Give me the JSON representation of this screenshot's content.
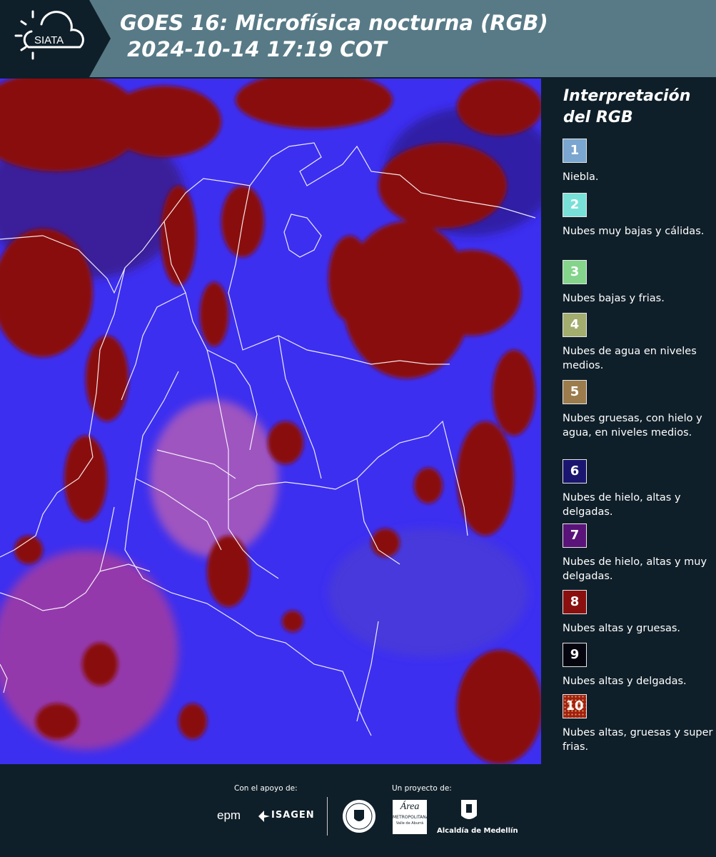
{
  "header": {
    "logo_text": "SIATA",
    "title_line1": "GOES 16: Microfísica nocturna (RGB)",
    "title_line2": " 2024-10-14 17:19 COT"
  },
  "legend": {
    "title_line1": "Interpretación",
    "title_line2": "del RGB",
    "items": [
      {
        "num": "1",
        "label": "Niebla.",
        "color": "#7aa6cf"
      },
      {
        "num": "2",
        "label": "Nubes muy bajas y cálidas.",
        "color": "#79e0d8"
      },
      {
        "num": "3",
        "label": "Nubes bajas y frias.",
        "color": "#84d48c"
      },
      {
        "num": "4",
        "label": "Nubes de agua en niveles medios.",
        "color": "#a2ad6e"
      },
      {
        "num": "5",
        "label": "Nubes gruesas, con hielo y agua, en niveles medios.",
        "color": "#9c7c4c"
      },
      {
        "num": "6",
        "label": "Nubes de hielo, altas y delgadas.",
        "color": "#1a1670"
      },
      {
        "num": "7",
        "label": "Nubes de hielo, altas y muy delgadas.",
        "color": "#5a1378"
      },
      {
        "num": "8",
        "label": "Nubes altas y gruesas.",
        "color": "#8a1010"
      },
      {
        "num": "9",
        "label": "Nubes altas y delgadas.",
        "color": "#050510"
      },
      {
        "num": "10",
        "label": "Nubes altas, gruesas y super frias.",
        "color": "#a02010"
      }
    ]
  },
  "footer": {
    "support_label": "Con el apoyo de:",
    "project_label": "Un proyecto de:",
    "logo_epm": "epm",
    "logo_isagen": "ISAGEN",
    "logo_area_line1": "Área",
    "logo_area_line2": "METROPOLITANA",
    "logo_area_line3": "Valle de Aburrá",
    "logo_medellin": "Alcaldía de Medellín"
  },
  "colors": {
    "header_bg": "#577a86",
    "page_bg": "#0f1f29",
    "map_blue": "#3d2ff0",
    "cloud_red": "#8a1010"
  }
}
